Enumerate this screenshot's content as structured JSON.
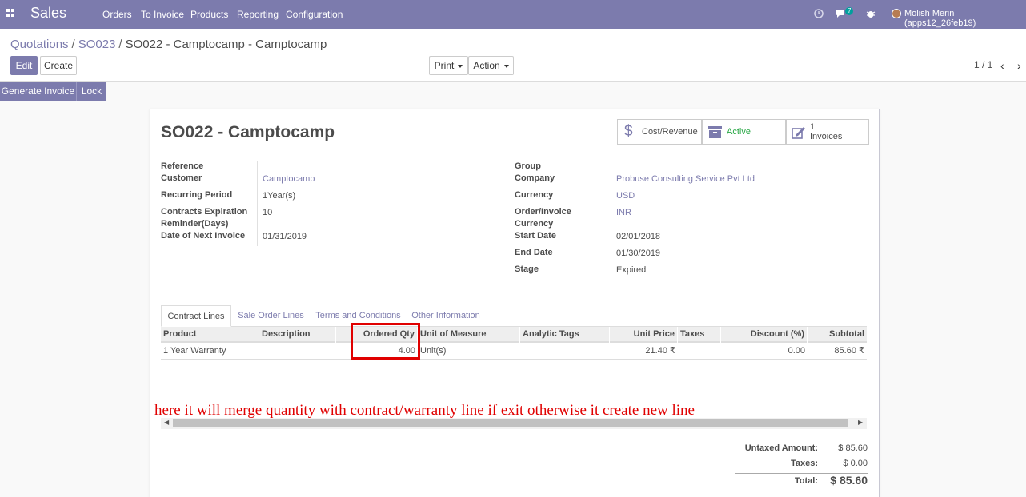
{
  "navbar": {
    "brand": "Sales",
    "menu": [
      "Orders",
      "To Invoice",
      "Products",
      "Reporting",
      "Configuration"
    ],
    "chat_badge": "7",
    "user": "Molish Merin (apps12_26feb19)"
  },
  "breadcrumb": {
    "parts": [
      "Quotations",
      "SO023"
    ],
    "current": "SO022 - Camptocamp - Camptocamp"
  },
  "toolbar": {
    "edit": "Edit",
    "create": "Create",
    "print": "Print",
    "action": "Action",
    "pager": "1 / 1"
  },
  "status_buttons": {
    "generate_invoice": "Generate Invoice",
    "lock": "Lock"
  },
  "smart_buttons": {
    "cost_revenue": "Cost/Revenue",
    "active": "Active",
    "invoices_count": "1",
    "invoices_label": "Invoices"
  },
  "record": {
    "title": "SO022 - Camptocamp",
    "left": {
      "reference_label": "Reference",
      "customer_label": "Customer",
      "customer": "Camptocamp",
      "recurring_label": "Recurring Period",
      "recurring": "1Year(s)",
      "expiration_label_1": "Contracts Expiration",
      "expiration_label_2": "Reminder(Days)",
      "expiration": "10",
      "next_invoice_label": "Date of Next Invoice",
      "next_invoice": "01/31/2019"
    },
    "right": {
      "group_label": "Group",
      "company_label": "Company",
      "company": "Probuse Consulting Service Pvt Ltd",
      "currency_label": "Currency",
      "currency": "USD",
      "oi_currency_label_1": "Order/Invoice",
      "oi_currency_label_2": "Currency",
      "oi_currency": "INR",
      "start_label": "Start Date",
      "start": "02/01/2018",
      "end_label": "End Date",
      "end": "01/30/2019",
      "stage_label": "Stage",
      "stage": "Expired"
    }
  },
  "tabs": [
    "Contract Lines",
    "Sale Order Lines",
    "Terms and Conditions",
    "Other Information"
  ],
  "table": {
    "headers": [
      "Product",
      "Description",
      "Ordered Qty",
      "Unit of Measure",
      "Analytic Tags",
      "Unit Price",
      "Taxes",
      "Discount (%)",
      "Subtotal"
    ],
    "row": {
      "product": "1 Year Warranty",
      "description": "",
      "qty": "4.00",
      "uom": "Unit(s)",
      "tags": "",
      "price": "21.40 ₹",
      "taxes": "",
      "discount": "0.00",
      "subtotal": "85.60 ₹"
    }
  },
  "annotation": "here it will merge quantity with contract/warranty line if exit otherwise it create new line",
  "totals": {
    "untaxed_label": "Untaxed Amount:",
    "untaxed": "$ 85.60",
    "taxes_label": "Taxes:",
    "taxes": "$ 0.00",
    "total_label": "Total:",
    "total": "$ 85.60"
  },
  "colors": {
    "brand": "#7c7bad",
    "annotation": "#e00000",
    "active": "#28a745"
  }
}
